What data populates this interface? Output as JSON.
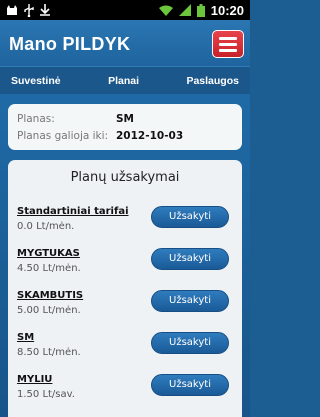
{
  "status_bar": {
    "time": "10:20",
    "icons_left": [
      "cat-icon",
      "usb-icon",
      "download-icon"
    ],
    "icons_right": [
      "wifi-icon",
      "signal-icon",
      "battery-icon"
    ]
  },
  "header": {
    "title": "Mano PILDYK",
    "menu_icon": "menu-icon",
    "accent_color": "#d9303a"
  },
  "tabs": [
    {
      "label": "Suvestinė"
    },
    {
      "label": "Planai"
    },
    {
      "label": "Paslaugos"
    }
  ],
  "plan_info": {
    "plan_label": "Planas:",
    "plan_value": "SM",
    "valid_label": "Planas galioja iki:",
    "valid_value": "2012-10-03"
  },
  "orders": {
    "title": "Planų užsakymai",
    "items": [
      {
        "name": "Standartiniai tarifai",
        "price": "0.0 Lt/mėn.",
        "button": "Užsakyti"
      },
      {
        "name": "MYGTUKAS",
        "price": "4.50 Lt/mėn.",
        "button": "Užsakyti"
      },
      {
        "name": "SKAMBUTIS",
        "price": "5.00 Lt/mėn.",
        "button": "Užsakyti"
      },
      {
        "name": "SM",
        "price": "8.50 Lt/mėn.",
        "button": "Užsakyti"
      },
      {
        "name": "MYLIU",
        "price": "1.50 Lt/sav.",
        "button": "Užsakyti"
      }
    ]
  }
}
